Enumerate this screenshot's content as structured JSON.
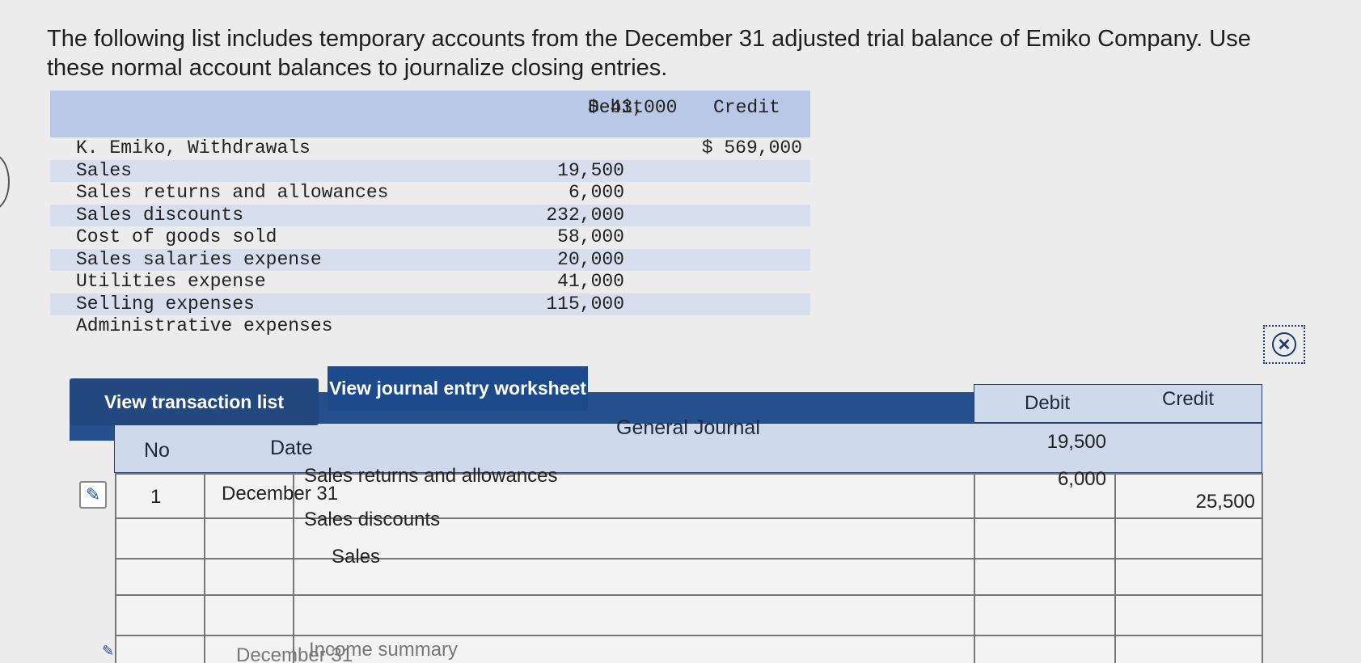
{
  "intro": "The following list includes temporary accounts from the December 31 adjusted trial balance of Emiko Company. Use these normal account balances to journalize closing entries.",
  "trial_balance": {
    "header_debit": "Debit",
    "header_credit": "Credit",
    "first_debit": "$ 43,000",
    "rows": [
      {
        "account": "K. Emiko, Withdrawals",
        "debit": "",
        "credit": "$ 569,000"
      },
      {
        "account": "Sales",
        "debit": "19,500",
        "credit": ""
      },
      {
        "account": "Sales returns and allowances",
        "debit": "6,000",
        "credit": ""
      },
      {
        "account": "Sales discounts",
        "debit": "232,000",
        "credit": ""
      },
      {
        "account": "Cost of goods sold",
        "debit": "58,000",
        "credit": ""
      },
      {
        "account": "Sales salaries expense",
        "debit": "20,000",
        "credit": ""
      },
      {
        "account": "Utilities expense",
        "debit": "41,000",
        "credit": ""
      },
      {
        "account": "Selling expenses",
        "debit": "115,000",
        "credit": ""
      },
      {
        "account": "Administrative expenses",
        "debit": "",
        "credit": ""
      }
    ]
  },
  "buttons": {
    "transaction_list": "View transaction list",
    "journal_worksheet": "View journal entry worksheet"
  },
  "icons": {
    "close": "close-icon",
    "edit": "pencil-icon"
  },
  "journal": {
    "col_no": "No",
    "col_date": "Date",
    "col_general_journal": "General Journal",
    "col_debit": "Debit",
    "col_credit": "Credit",
    "entry1": {
      "no": "1",
      "date": "December 31",
      "lines": [
        {
          "account": "Sales returns and allowances",
          "debit": "19,500",
          "credit": ""
        },
        {
          "account": "Sales discounts",
          "debit": "6,000",
          "credit": ""
        },
        {
          "account": "Sales",
          "debit": "",
          "credit": "25,500"
        }
      ]
    },
    "entry2": {
      "date": "December 31",
      "account": "Income summary"
    }
  }
}
